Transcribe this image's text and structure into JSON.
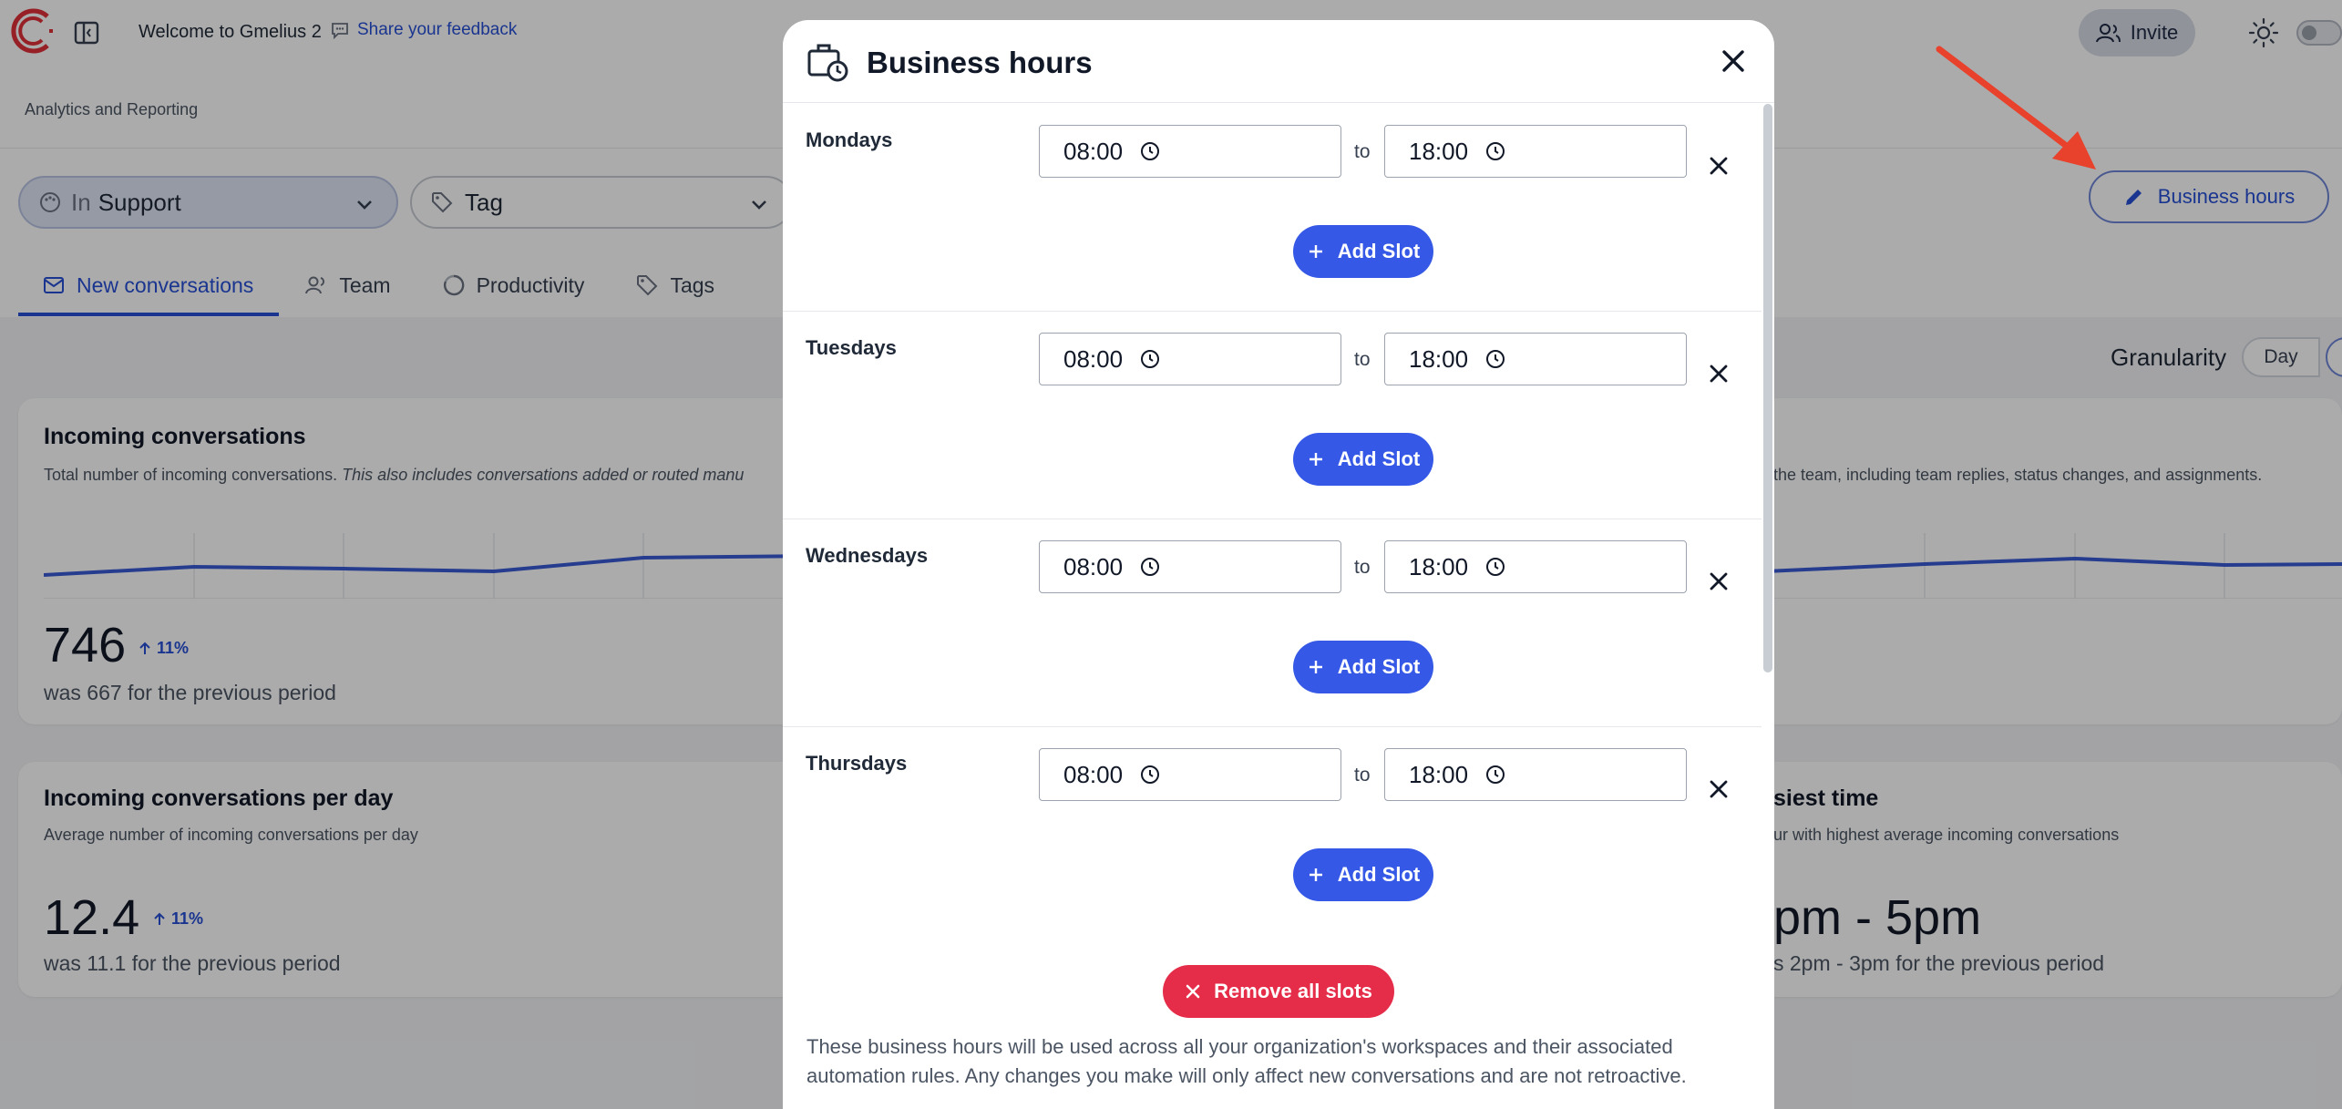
{
  "topbar": {
    "welcome": "Welcome to Gmelius 2",
    "feedback_label": "Share your feedback",
    "invite_label": "Invite"
  },
  "breadcrumb": "Analytics and Reporting",
  "filters": {
    "support_prefix": "In",
    "support_value": "Support",
    "tag_label": "Tag"
  },
  "business_hours_button": "Business hours",
  "tabs": [
    {
      "label": "New conversations",
      "icon": "mail-icon",
      "active": true
    },
    {
      "label": "Team",
      "icon": "team-icon",
      "active": false
    },
    {
      "label": "Productivity",
      "icon": "productivity-icon",
      "active": false
    },
    {
      "label": "Tags",
      "icon": "tag-icon",
      "active": false
    }
  ],
  "granularity": {
    "label": "Granularity",
    "selected": "Day"
  },
  "cards": {
    "incoming": {
      "title": "Incoming conversations",
      "desc_plain": "Total number of incoming conversations. ",
      "desc_italic": "This also includes conversations added or routed manu",
      "value": "746",
      "delta": "11%",
      "previous": "was 667 for the previous period"
    },
    "team": {
      "desc": "the team, including team replies, status changes, and assignments."
    },
    "per_day": {
      "title": "Incoming conversations per day",
      "desc": "Average number of incoming conversations per day",
      "value": "12.4",
      "delta": "11%",
      "previous": "was 11.1 for the previous period"
    },
    "busiest": {
      "title": "siest time",
      "desc": "ur with highest average incoming conversations",
      "value": "pm - 5pm",
      "previous": "s 2pm - 3pm for the previous period"
    }
  },
  "modal": {
    "title": "Business hours",
    "to_label": "to",
    "add_slot_label": "Add Slot",
    "days": [
      {
        "name": "Mondays",
        "from": "08:00",
        "to": "18:00"
      },
      {
        "name": "Tuesdays",
        "from": "08:00",
        "to": "18:00"
      },
      {
        "name": "Wednesdays",
        "from": "08:00",
        "to": "18:00"
      },
      {
        "name": "Thursdays",
        "from": "08:00",
        "to": "18:00"
      }
    ],
    "remove_all_label": "Remove all slots",
    "footer_note": "These business hours will be used across all your organization's workspaces and their associated automation rules. Any changes you make will only affect new conversations and are not retroactive."
  },
  "colors": {
    "accent": "#3559e6",
    "danger": "#e52d49",
    "link": "#2750d6",
    "arrow": "#e8412c"
  }
}
